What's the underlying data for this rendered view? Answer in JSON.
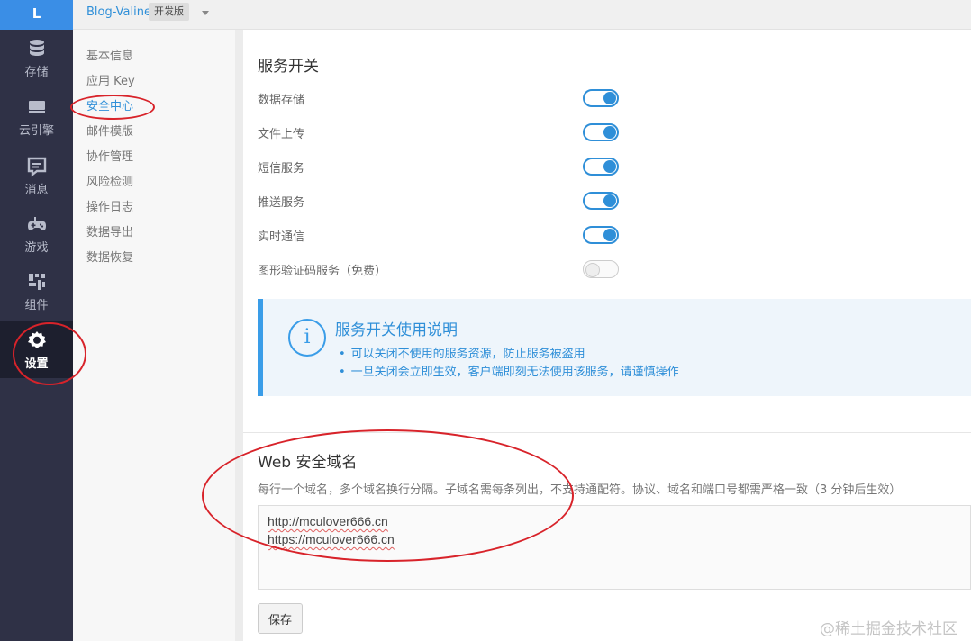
{
  "rail": {
    "logo": "L",
    "items": [
      {
        "label": "存储",
        "icon": "database-icon"
      },
      {
        "label": "云引擎",
        "icon": "server-icon"
      },
      {
        "label": "消息",
        "icon": "message-icon"
      },
      {
        "label": "游戏",
        "icon": "gamepad-icon"
      },
      {
        "label": "组件",
        "icon": "components-icon"
      },
      {
        "label": "设置",
        "icon": "gear-icon",
        "active": true
      }
    ]
  },
  "topbar": {
    "app_name": "Blog-Valine",
    "env_badge": "开发版"
  },
  "subnav": {
    "items": [
      "基本信息",
      "应用 Key",
      "安全中心",
      "邮件模版",
      "协作管理",
      "风险检测",
      "操作日志",
      "数据导出",
      "数据恢复"
    ],
    "active": "安全中心"
  },
  "services": {
    "title": "服务开关",
    "rows": [
      {
        "label": "数据存储",
        "enabled": true
      },
      {
        "label": "文件上传",
        "enabled": true
      },
      {
        "label": "短信服务",
        "enabled": true
      },
      {
        "label": "推送服务",
        "enabled": true
      },
      {
        "label": "实时通信",
        "enabled": true
      },
      {
        "label": "图形验证码服务（免费）",
        "enabled": false
      }
    ]
  },
  "info": {
    "title": "服务开关使用说明",
    "lines": [
      "可以关闭不使用的服务资源，防止服务被盗用",
      "一旦关闭会立即生效，客户端即刻无法使用该服务，请谨慎操作"
    ]
  },
  "web_domains": {
    "title": "Web 安全域名",
    "description": "每行一个域名，多个域名换行分隔。子域名需每条列出，不支持通配符。协议、域名和端口号都需严格一致（3 分钟后生效）",
    "lines": [
      "http://mculover666.cn",
      "https://mculover666.cn"
    ],
    "save_label": "保存"
  },
  "watermark": "@稀土掘金技术社区",
  "colors": {
    "accent": "#2f8fd8",
    "rail_bg": "#2f3146",
    "annotation": "#d8232a"
  }
}
